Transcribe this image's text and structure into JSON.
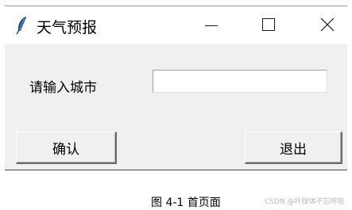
{
  "window": {
    "title": "天气预报",
    "icon": "feather-icon",
    "controls": {
      "minimize": "minimize-icon",
      "maximize": "maximize-icon",
      "close": "close-icon"
    }
  },
  "form": {
    "city_label": "请输入城市",
    "city_input_value": "",
    "confirm_label": "确认",
    "exit_label": "退出"
  },
  "caption": "图 4-1 首页面",
  "watermark": "CSDN @叶绿体不忘呼吸",
  "colors": {
    "window_bg": "#f0f0f0",
    "titlebar_bg": "#ffffff",
    "input_bg": "#ffffff"
  }
}
